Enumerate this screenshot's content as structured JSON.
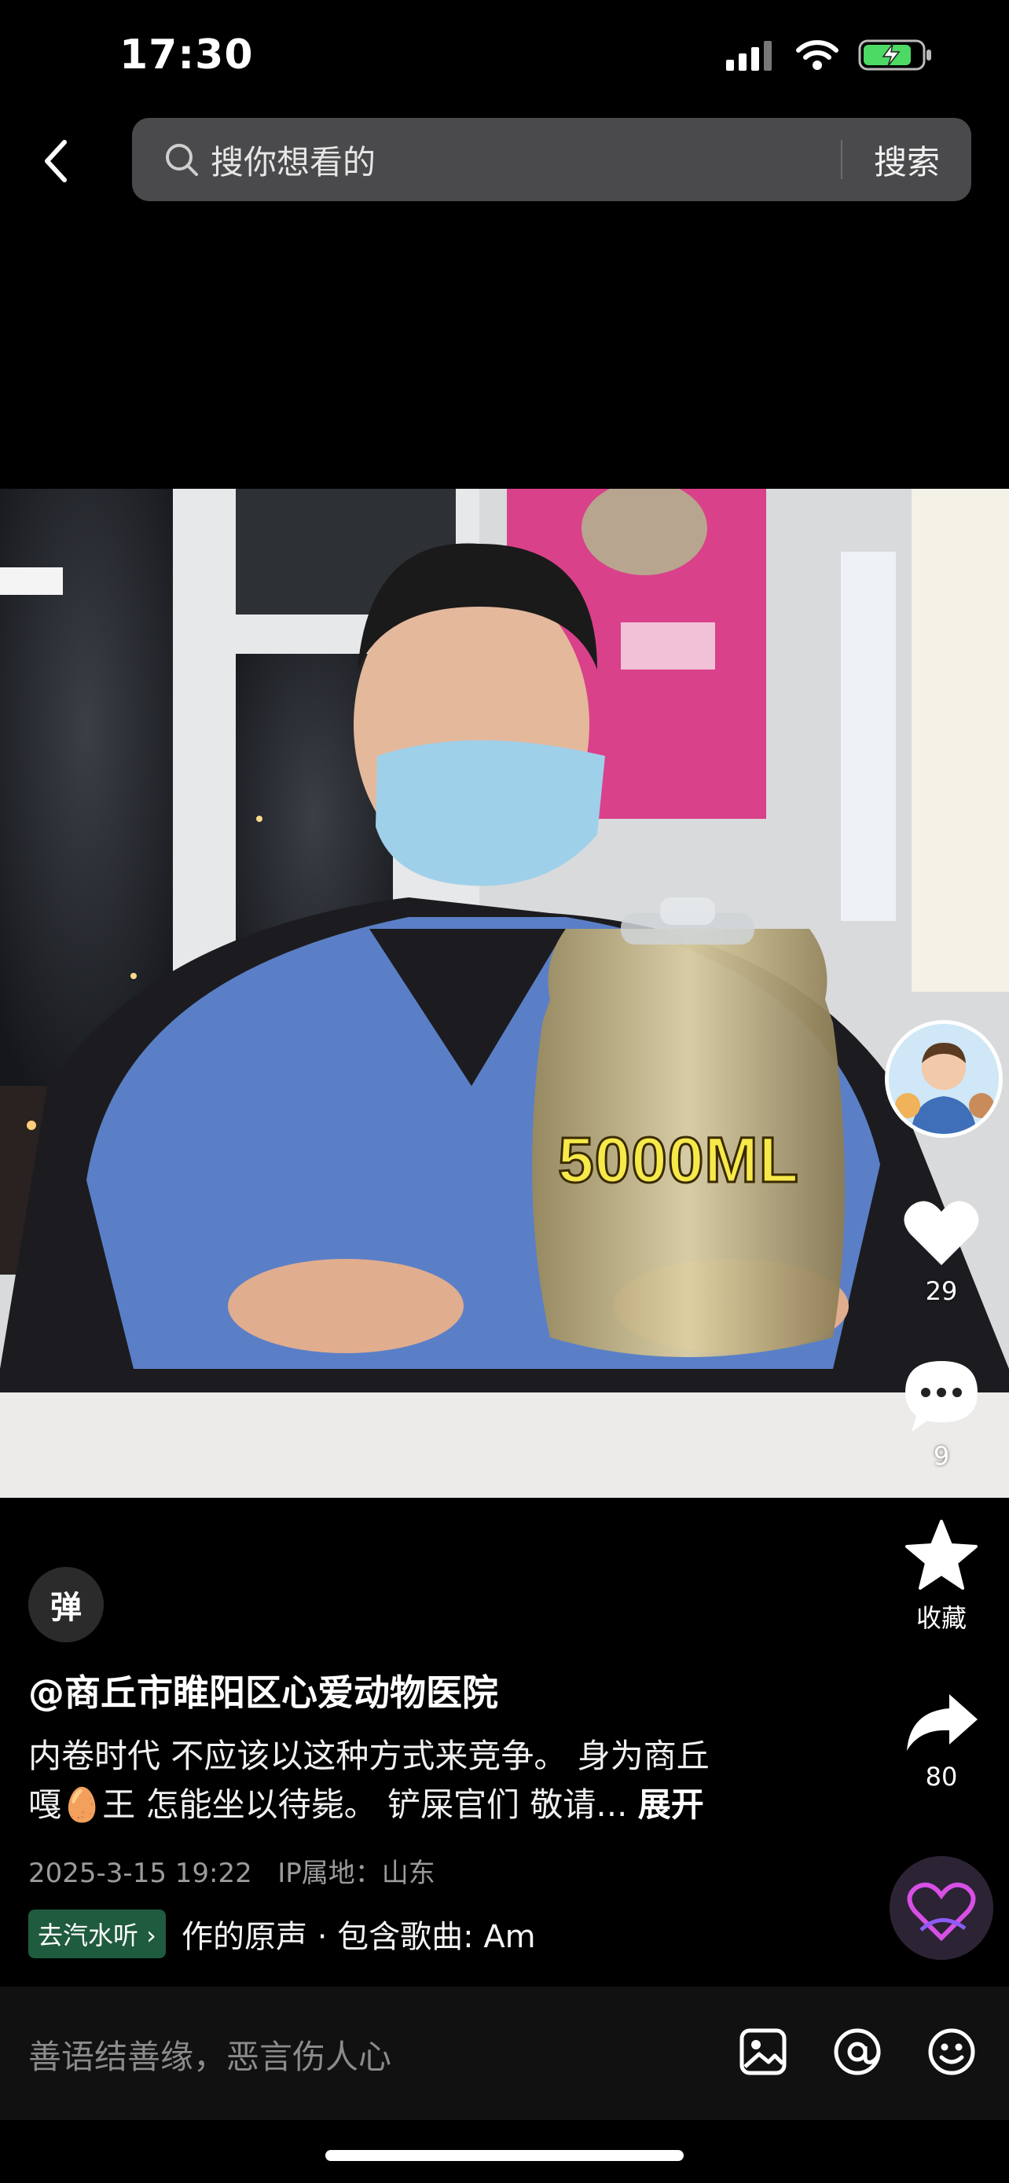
{
  "status_bar": {
    "time": "17:30"
  },
  "search": {
    "placeholder": "搜你想看的",
    "button": "搜索"
  },
  "video": {
    "overlay_text": "5000ML"
  },
  "actions": {
    "likes": "29",
    "comments": "9",
    "favorite_label": "收藏",
    "shares": "80"
  },
  "danmu": {
    "label": "弹"
  },
  "post": {
    "author": "@商丘市睢阳区心爱动物医院",
    "description_line1": "内卷时代 不应该以这种方式来竞争。 身为商丘",
    "description_line2": "嘎🥚王 怎能坐以待毙。 铲屎官们 敬请...",
    "expand_label": "展开",
    "date": "2025-3-15 19:22",
    "ip_location": "IP属地：山东"
  },
  "music": {
    "badge": "去汽水听 ›",
    "text": "作的原声 · 包含歌曲: Am"
  },
  "comment_bar": {
    "placeholder": "善语结善缘，恶言伤人心"
  },
  "colors": {
    "background": "#000000",
    "search_bg": "#4a4a4c",
    "overlay_yellow": "#f6e94a",
    "scrubs_blue": "#5b7fc6"
  },
  "icons": [
    "back-icon",
    "search-icon",
    "heart-icon",
    "comment-icon",
    "star-icon",
    "share-icon",
    "image-icon",
    "at-icon",
    "emoji-icon"
  ]
}
